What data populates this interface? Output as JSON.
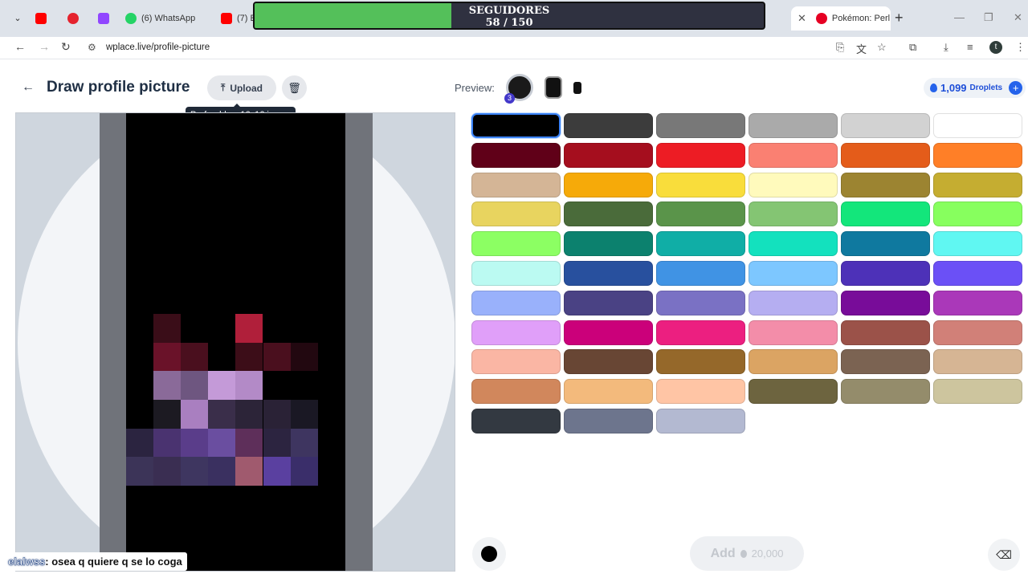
{
  "browser": {
    "tabs": [
      {
        "label": "",
        "favicon_color": "#ff0000"
      },
      {
        "label": "",
        "favicon_color": "#e5232e"
      },
      {
        "label": "",
        "favicon_color": "#9146ff"
      },
      {
        "label": "(6) WhatsApp",
        "favicon_color": "#25d366"
      },
      {
        "label": "(7) E",
        "favicon_color": "#ff0000"
      },
      {
        "label": "Pokémon: Perl",
        "favicon_color": "#e60023"
      }
    ],
    "url": "wplace.live/profile-picture",
    "profile_initial": "t"
  },
  "overlay": {
    "title": "SEGUIDORES",
    "current": 58,
    "goal": 150,
    "progress_text": "58 / 150",
    "bar_color": "#54c05a"
  },
  "header": {
    "title": "Draw profile picture",
    "upload_label": "Upload",
    "tooltip": "Preferably a 16x16 image",
    "preview_label": "Preview:",
    "preview_badge": "3",
    "droplets_count": "1,099",
    "droplets_unit": "Droplets"
  },
  "palette": {
    "selected_index": 0,
    "colors": [
      "#000000",
      "#3c3c3c",
      "#787878",
      "#aaaaaa",
      "#d2d2d2",
      "#ffffff",
      "#600018",
      "#a50e1e",
      "#ed1c24",
      "#fa8072",
      "#e45c1a",
      "#ff7f27",
      "#d4b596",
      "#f6aa09",
      "#f9dd3b",
      "#fffabc",
      "#9c8431",
      "#c5ad31",
      "#e8d45f",
      "#4a6b3a",
      "#5a944a",
      "#84c573",
      "#13e67b",
      "#87ff5e",
      "#8cff63",
      "#0c816e",
      "#10aea6",
      "#13e1be",
      "#0f799f",
      "#60f7f2",
      "#bbfaf2",
      "#28509e",
      "#4093e4",
      "#7dc7ff",
      "#4d31b8",
      "#6b50f6",
      "#99b1fb",
      "#4a4284",
      "#7a71c4",
      "#b5aef1",
      "#780c99",
      "#aa38b9",
      "#e09ff9",
      "#cb007a",
      "#ec1f80",
      "#f38da9",
      "#9b5249",
      "#d18078",
      "#fab6a4",
      "#684634",
      "#95682a",
      "#dba463",
      "#7b6352",
      "#d6b594",
      "#d1875c",
      "#f3ba7c",
      "#ffc5a5",
      "#6d643f",
      "#948c6b",
      "#cdc59e",
      "#333941",
      "#6d758d",
      "#b3b9d1"
    ]
  },
  "canvas": {
    "grid_cols": 8,
    "pixels": [
      {
        "r": 7,
        "c": 1,
        "color": "#3a0d18"
      },
      {
        "r": 7,
        "c": 4,
        "color": "#b01f3a"
      },
      {
        "r": 8,
        "c": 1,
        "color": "#6a1229"
      },
      {
        "r": 8,
        "c": 2,
        "color": "#4a0f1e"
      },
      {
        "r": 8,
        "c": 4,
        "color": "#3c0d18"
      },
      {
        "r": 8,
        "c": 5,
        "color": "#4a0f1e"
      },
      {
        "r": 8,
        "c": 6,
        "color": "#220810"
      },
      {
        "r": 9,
        "c": 1,
        "color": "#8a6a99"
      },
      {
        "r": 9,
        "c": 2,
        "color": "#6e5680"
      },
      {
        "r": 9,
        "c": 3,
        "color": "#c49ad8"
      },
      {
        "r": 9,
        "c": 4,
        "color": "#b38ac7"
      },
      {
        "r": 10,
        "c": 1,
        "color": "#1c1a22"
      },
      {
        "r": 10,
        "c": 2,
        "color": "#a97fc0"
      },
      {
        "r": 10,
        "c": 3,
        "color": "#3a2e4a"
      },
      {
        "r": 10,
        "c": 4,
        "color": "#2c2438"
      },
      {
        "r": 10,
        "c": 5,
        "color": "#2a2236"
      },
      {
        "r": 10,
        "c": 6,
        "color": "#1a1824"
      },
      {
        "r": 11,
        "c": 0,
        "color": "#2b2440"
      },
      {
        "r": 11,
        "c": 1,
        "color": "#4a3370"
      },
      {
        "r": 11,
        "c": 2,
        "color": "#5a3d8a"
      },
      {
        "r": 11,
        "c": 3,
        "color": "#6a4ea0"
      },
      {
        "r": 11,
        "c": 4,
        "color": "#5e2f5a"
      },
      {
        "r": 11,
        "c": 5,
        "color": "#2c2440"
      },
      {
        "r": 11,
        "c": 6,
        "color": "#3e3560"
      },
      {
        "r": 12,
        "c": 0,
        "color": "#3c3458"
      },
      {
        "r": 12,
        "c": 1,
        "color": "#3a2e52"
      },
      {
        "r": 12,
        "c": 2,
        "color": "#3e3660"
      },
      {
        "r": 12,
        "c": 3,
        "color": "#3a3060"
      },
      {
        "r": 12,
        "c": 4,
        "color": "#a05a6e"
      },
      {
        "r": 12,
        "c": 5,
        "color": "#5a40a0"
      },
      {
        "r": 12,
        "c": 6,
        "color": "#3a2e6a"
      }
    ]
  },
  "bottom": {
    "current_color": "#000000",
    "add_label": "Add",
    "add_cost": "20,000"
  },
  "chat": {
    "user": "elalwss",
    "message": ": osea q quiere q se lo coga"
  }
}
